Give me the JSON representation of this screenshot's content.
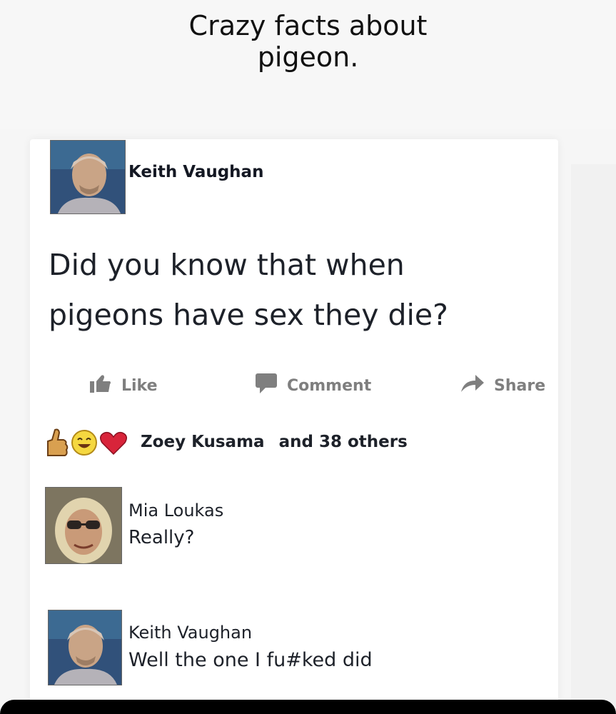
{
  "header": {
    "title_line1": "Crazy facts about",
    "title_line2": "pigeon."
  },
  "post": {
    "author": "Keith Vaughan",
    "text_line1": "Did you know that when",
    "text_line2": "pigeons have sex they die?"
  },
  "actions": {
    "like": "Like",
    "comment": "Comment",
    "share": "Share"
  },
  "reactions": {
    "names": "Zoey Kusama",
    "others": "and 38 others"
  },
  "comments": [
    {
      "author": "Mia Loukas",
      "text": "Really?"
    },
    {
      "author": "Keith Vaughan",
      "text": "Well the one I fu#ked did"
    }
  ],
  "colors": {
    "text": "#1d2129",
    "muted": "#7f7f7f",
    "background": "#f6f6f6",
    "card": "#ffffff"
  }
}
